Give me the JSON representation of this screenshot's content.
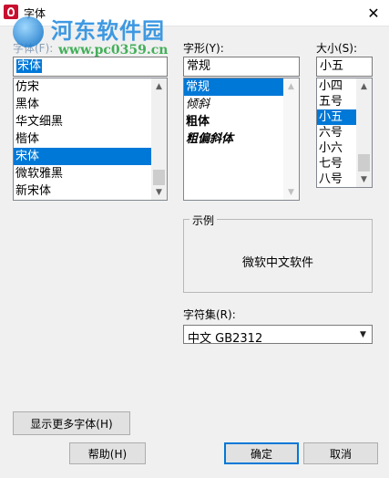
{
  "window": {
    "title": "字体",
    "icon": "app-font-icon",
    "close_glyph": "✕"
  },
  "watermark": {
    "site_name": "河东软件园",
    "url": "www.pc0359.cn"
  },
  "font_section": {
    "label": "字体(F):",
    "value": "宋体",
    "items": [
      "仿宋",
      "黑体",
      "华文细黑",
      "楷体",
      "宋体",
      "微软雅黑",
      "新宋体"
    ],
    "selected_index": 4
  },
  "style_section": {
    "label": "字形(Y):",
    "value": "常规",
    "items": [
      "常规",
      "倾斜",
      "粗体",
      "粗偏斜体"
    ],
    "selected_index": 0
  },
  "size_section": {
    "label": "大小(S):",
    "value": "小五",
    "items": [
      "小四",
      "五号",
      "小五",
      "六号",
      "小六",
      "七号",
      "八号"
    ],
    "selected_index": 2
  },
  "sample": {
    "title": "示例",
    "text": "微软中文软件"
  },
  "charset": {
    "label": "字符集(R):",
    "value": "中文 GB2312"
  },
  "buttons": {
    "more_fonts": "显示更多字体(H)",
    "help": "帮助(H)",
    "ok": "确定",
    "cancel": "取消"
  },
  "colors": {
    "selection": "#0078d7",
    "watermark_blue": "#2a8fe0",
    "watermark_green": "#31a84a"
  }
}
